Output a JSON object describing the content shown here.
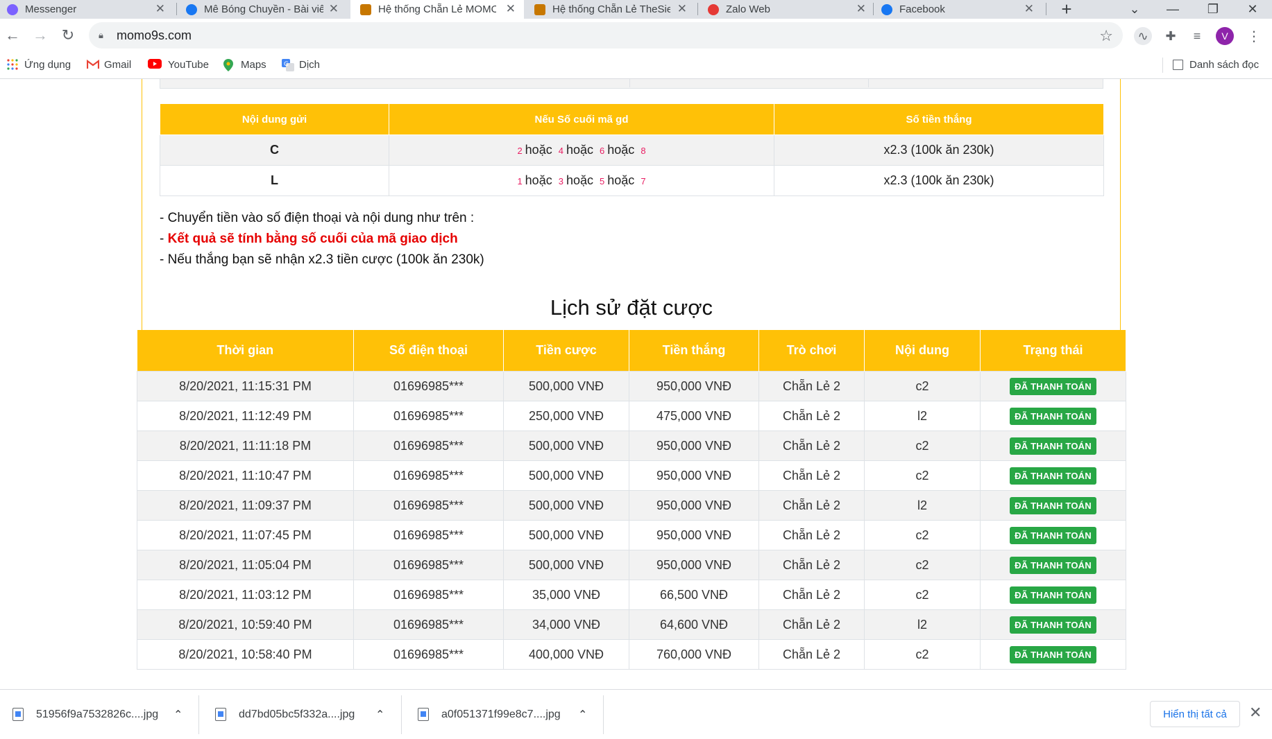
{
  "browser": {
    "tabs": [
      {
        "label": "Messenger",
        "icon": "messenger-icon",
        "color": "#7b61ff"
      },
      {
        "label": "Mê Bóng Chuyền - Bài viế",
        "icon": "facebook-icon",
        "color": "#1877f2"
      },
      {
        "label": "Hệ thống Chẵn Lẻ MOMO",
        "icon": "site-icon",
        "color": "#c77700"
      },
      {
        "label": "Hệ thống Chẵn Lẻ TheSie",
        "icon": "site-icon",
        "color": "#c77700"
      },
      {
        "label": "Zalo Web",
        "icon": "zalo-icon",
        "color": "#e53935"
      },
      {
        "label": "Facebook",
        "icon": "facebook-icon",
        "color": "#1877f2"
      }
    ],
    "new_tab": "+",
    "url": "momo9s.com",
    "avatar_letter": "V",
    "bookmarks": [
      {
        "label": "Ứng dụng",
        "icon": "apps-icon"
      },
      {
        "label": "Gmail",
        "icon": "gmail-icon"
      },
      {
        "label": "YouTube",
        "icon": "youtube-icon"
      },
      {
        "label": "Maps",
        "icon": "maps-icon"
      },
      {
        "label": "Dịch",
        "icon": "translate-icon"
      }
    ],
    "reading_list": "Danh sách đọc"
  },
  "rules": {
    "headers": [
      "Nội dung gửi",
      "Nếu Số cuối mã gd",
      "Số tiền thắng"
    ],
    "rows": [
      {
        "code": "C",
        "digits": [
          "2",
          "4",
          "6",
          "8"
        ],
        "payout": "x2.3 (100k ăn 230k)"
      },
      {
        "code": "L",
        "digits": [
          "1",
          "3",
          "5",
          "7"
        ],
        "payout": "x2.3 (100k ăn 230k)"
      }
    ],
    "or_word": "hoặc",
    "notes": [
      "- Chuyển tiền vào số điện thoại và nội dung như trên :",
      "Kết quả sẽ tính bằng số cuối của mã giao dịch",
      "- Nếu thắng bạn sẽ nhận x2.3 tiền cược (100k ăn 230k)"
    ]
  },
  "history": {
    "title": "Lịch sử đặt cược",
    "headers": [
      "Thời gian",
      "Số điện thoại",
      "Tiền cược",
      "Tiền thắng",
      "Trò chơi",
      "Nội dung",
      "Trạng thái"
    ],
    "rows": [
      [
        "8/20/2021, 11:15:31 PM",
        "01696985***",
        "500,000 VNĐ",
        "950,000 VNĐ",
        "Chẵn Lẻ 2",
        "c2",
        "ĐÃ THANH TOÁN"
      ],
      [
        "8/20/2021, 11:12:49 PM",
        "01696985***",
        "250,000 VNĐ",
        "475,000 VNĐ",
        "Chẵn Lẻ 2",
        "l2",
        "ĐÃ THANH TOÁN"
      ],
      [
        "8/20/2021, 11:11:18 PM",
        "01696985***",
        "500,000 VNĐ",
        "950,000 VNĐ",
        "Chẵn Lẻ 2",
        "c2",
        "ĐÃ THANH TOÁN"
      ],
      [
        "8/20/2021, 11:10:47 PM",
        "01696985***",
        "500,000 VNĐ",
        "950,000 VNĐ",
        "Chẵn Lẻ 2",
        "c2",
        "ĐÃ THANH TOÁN"
      ],
      [
        "8/20/2021, 11:09:37 PM",
        "01696985***",
        "500,000 VNĐ",
        "950,000 VNĐ",
        "Chẵn Lẻ 2",
        "l2",
        "ĐÃ THANH TOÁN"
      ],
      [
        "8/20/2021, 11:07:45 PM",
        "01696985***",
        "500,000 VNĐ",
        "950,000 VNĐ",
        "Chẵn Lẻ 2",
        "c2",
        "ĐÃ THANH TOÁN"
      ],
      [
        "8/20/2021, 11:05:04 PM",
        "01696985***",
        "500,000 VNĐ",
        "950,000 VNĐ",
        "Chẵn Lẻ 2",
        "c2",
        "ĐÃ THANH TOÁN"
      ],
      [
        "8/20/2021, 11:03:12 PM",
        "01696985***",
        "35,000 VNĐ",
        "66,500 VNĐ",
        "Chẵn Lẻ 2",
        "c2",
        "ĐÃ THANH TOÁN"
      ],
      [
        "8/20/2021, 10:59:40 PM",
        "01696985***",
        "34,000 VNĐ",
        "64,600 VNĐ",
        "Chẵn Lẻ 2",
        "l2",
        "ĐÃ THANH TOÁN"
      ],
      [
        "8/20/2021, 10:58:40 PM",
        "01696985***",
        "400,000 VNĐ",
        "760,000 VNĐ",
        "Chẵn Lẻ 2",
        "c2",
        "ĐÃ THANH TOÁN"
      ]
    ]
  },
  "downloads": {
    "items": [
      "51956f9a7532826c....jpg",
      "dd7bd05bc5f332a....jpg",
      "a0f051371f99e8c7....jpg"
    ],
    "show_all": "Hiển thị tất cả"
  },
  "colors": {
    "accent": "#ffc107",
    "paid": "#28a745",
    "highlight": "#e60000"
  }
}
